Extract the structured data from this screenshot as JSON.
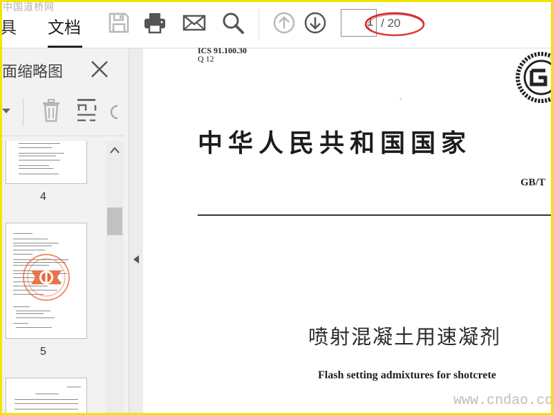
{
  "watermarks": {
    "top": "中国道桥网",
    "bottom": "www.cndao.com"
  },
  "toolbar": {
    "tabs": [
      {
        "label": "具"
      },
      {
        "label": "文档"
      }
    ],
    "icons": [
      "save-icon",
      "print-icon",
      "email-icon",
      "search-icon",
      "previous-page-icon",
      "next-page-icon"
    ],
    "page_input_value": "1",
    "page_total": "/ 20",
    "highlight_color": "#d0242a"
  },
  "sidebar": {
    "title": "面缩略图",
    "icons": [
      "dropdown-icon",
      "delete-icon",
      "extract-icon",
      "rotate-icon"
    ],
    "thumbnails": [
      {
        "page_label": "4"
      },
      {
        "page_label": "5"
      },
      {
        "page_label": ""
      }
    ]
  },
  "document": {
    "ics_line": "ICS 91.100.30",
    "q_line": "Q 12",
    "national_title": "中华人民共和国国家",
    "gb_code": "GB/T",
    "cn_title": "喷射混凝土用速凝剂",
    "en_title": "Flash setting admixtures for shotcrete"
  },
  "colors": {
    "frame": "#f2e600",
    "stamp": "#e8683c"
  }
}
